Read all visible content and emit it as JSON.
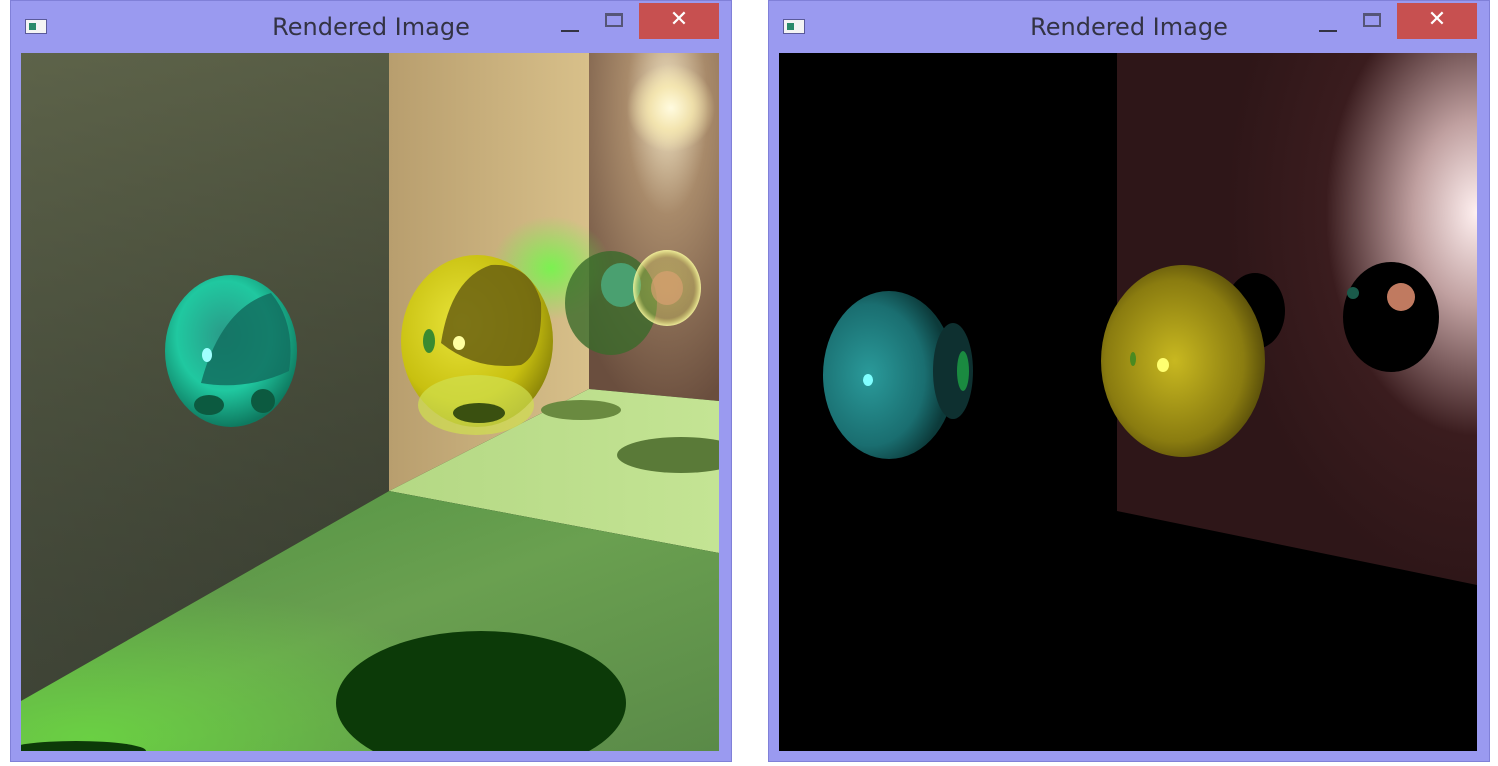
{
  "windows": [
    {
      "title": "Rendered Image",
      "controls": {
        "minimize_icon": "minimize-icon",
        "maximize_icon": "maximize-icon",
        "close_glyph": "✕"
      }
    },
    {
      "title": "Rendered Image",
      "controls": {
        "minimize_icon": "minimize-icon",
        "maximize_icon": "maximize-icon",
        "close_glyph": "✕"
      }
    }
  ],
  "colors": {
    "titlebar": "#9a9af0",
    "close_button": "#c75050",
    "sphere_cyan": "#1fc8a8",
    "sphere_yellow": "#d8d410",
    "floor_green": "#5a9a48"
  }
}
